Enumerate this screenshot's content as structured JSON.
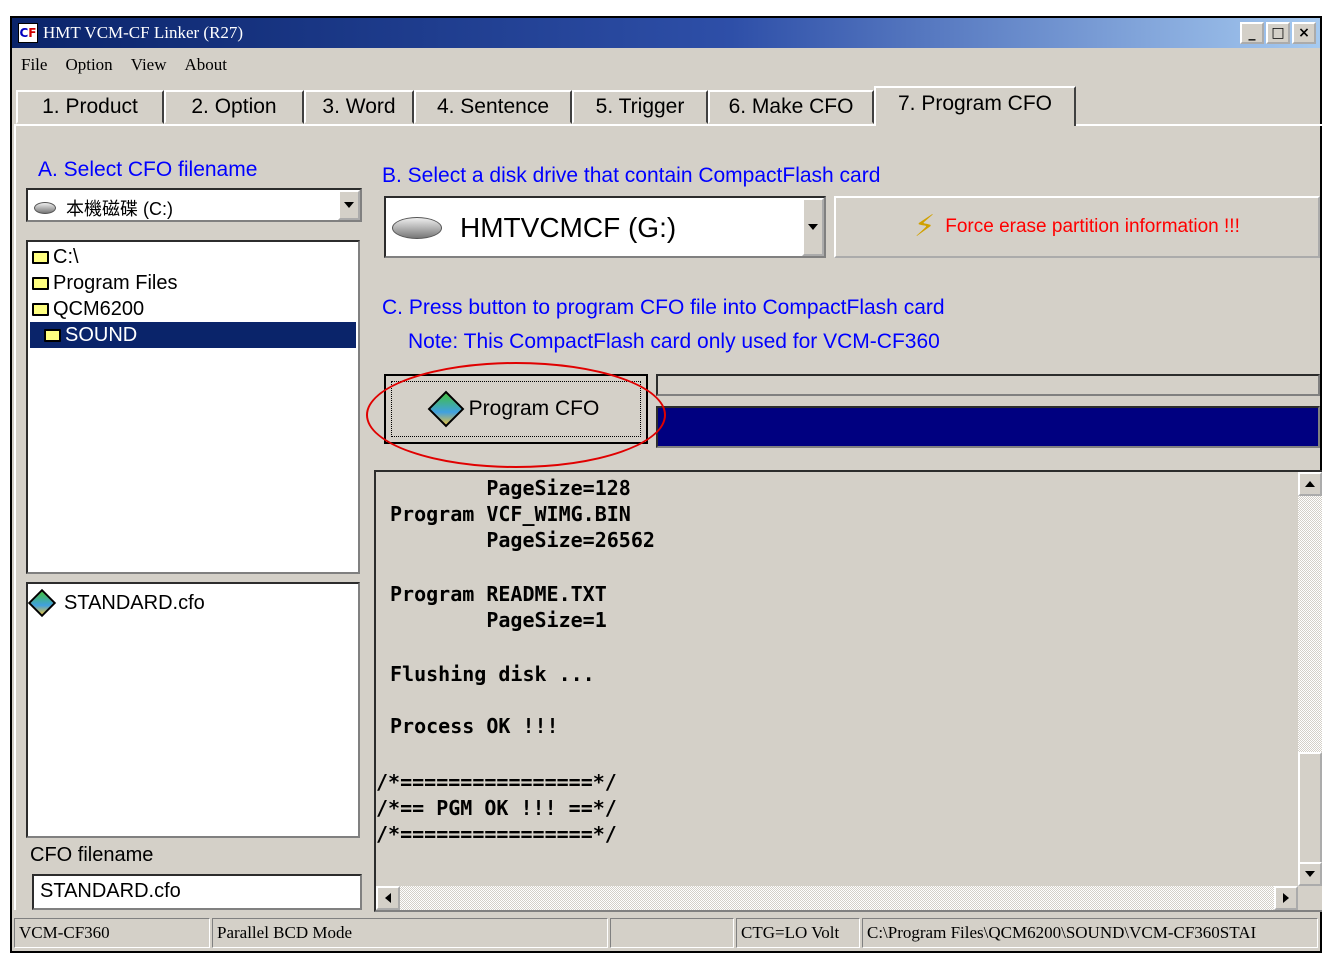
{
  "window": {
    "title": "HMT VCM-CF Linker (R27)",
    "icon_text_1": "C",
    "icon_text_2": "F"
  },
  "window_controls": {
    "minimize": "_",
    "maximize": "□",
    "close": "×"
  },
  "menu": [
    "File",
    "Option",
    "View",
    "About"
  ],
  "tabs": [
    "1. Product",
    "2. Option",
    "3. Word",
    "4. Sentence",
    "5. Trigger",
    "6. Make CFO",
    "7. Program CFO"
  ],
  "active_tab": "7. Program CFO",
  "left_panel": {
    "section_label": "A. Select CFO filename",
    "drive_combo_value": "本機磁碟 (C:)",
    "folders": [
      "C:\\",
      "Program Files",
      "QCM6200",
      "SOUND"
    ],
    "selected_folder": "SOUND",
    "files": [
      "STANDARD.cfo"
    ],
    "filename_label": "CFO filename",
    "filename_value": "STANDARD.cfo"
  },
  "right_panel": {
    "section_b_label": "B. Select a disk drive that contain CompactFlash card",
    "disk_combo_value": "HMTVCMCF (G:)",
    "force_erase_label": "Force erase partition information !!!",
    "section_c_label": "C. Press button to program CFO file into CompactFlash card",
    "note_label": "Note: This CompactFlash card only used for VCM-CF360",
    "program_button_label": "Program CFO",
    "progress_fraction": 1.0,
    "log_lines": [
      "        PageSize=128",
      "Program VCF_WIMG.BIN",
      "        PageSize=26562",
      "",
      "Program README.TXT",
      "        PageSize=1",
      "",
      "Flushing disk ...",
      "",
      "Process OK !!!",
      "",
      "/*================*/",
      "/*== PGM OK !!! ==*/",
      "/*================*/"
    ]
  },
  "statusbar": [
    "VCM-CF360",
    "Parallel BCD Mode",
    "",
    "CTG=LO Volt",
    "C:\\Program Files\\QCM6200\\SOUND\\VCM-CF360STAI"
  ],
  "colors": {
    "title_start": "#0a246a",
    "accent_blue": "#0000ff",
    "warning_red": "#ff0000",
    "selection": "#0a246a",
    "progress_fill": "#000080",
    "annotation": "#e00000"
  }
}
